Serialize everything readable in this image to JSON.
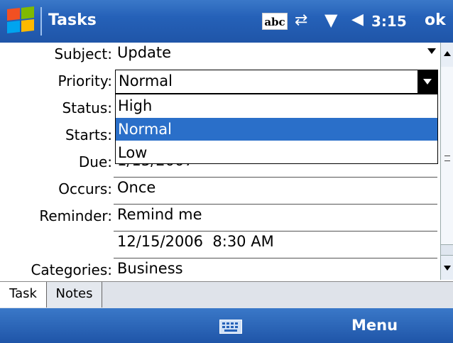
{
  "titlebar": {
    "app_title": "Tasks",
    "input_indicator": "abc",
    "clock": "3:15",
    "ok_label": "ok"
  },
  "form": {
    "subject": {
      "label": "Subject:",
      "value": "Update"
    },
    "priority": {
      "label": "Priority:",
      "value": "Normal",
      "options": [
        "High",
        "Normal",
        "Low"
      ],
      "selected": "Normal"
    },
    "status": {
      "label": "Status:"
    },
    "starts": {
      "label": "Starts:"
    },
    "due": {
      "label": "Due:",
      "value": "1/15/2007"
    },
    "occurs": {
      "label": "Occurs:",
      "value": "Once"
    },
    "reminder": {
      "label": "Reminder:",
      "value": "Remind me"
    },
    "reminder_time": {
      "value": "12/15/2006  8:30 AM"
    },
    "categories": {
      "label": "Categories:",
      "value": "Business"
    }
  },
  "tabs": [
    {
      "label": "Task"
    },
    {
      "label": "Notes"
    }
  ],
  "menubar": {
    "menu_label": "Menu"
  },
  "colors": {
    "bar_blue": "#2561b8",
    "selection": "#2a6fc9"
  },
  "icons": [
    "windows-start-icon",
    "connectivity-icon",
    "signal-icon",
    "volume-icon",
    "keyboard-icon"
  ]
}
